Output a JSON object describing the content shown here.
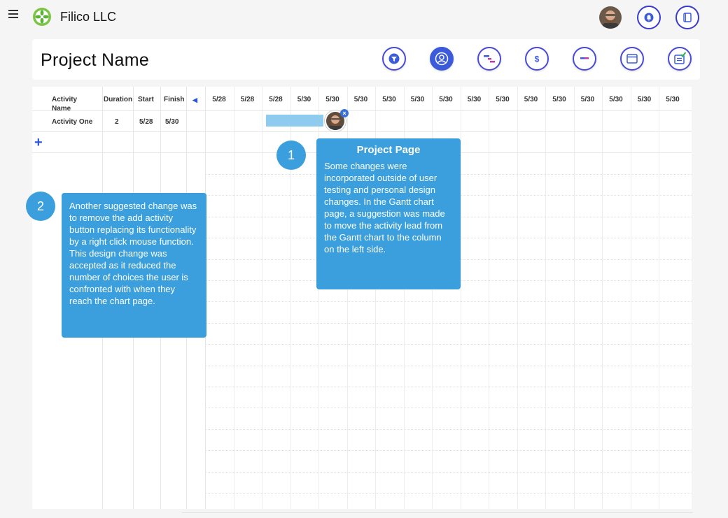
{
  "app": {
    "name": "Filico LLC"
  },
  "header": {
    "project_title": "Project Name"
  },
  "gantt": {
    "columns": {
      "activity_name": "Activity Name",
      "duration": "Duration",
      "start": "Start",
      "finish": "Finish"
    },
    "dates": [
      "5/28",
      "5/28",
      "5/28",
      "5/30",
      "5/30",
      "5/30",
      "5/30",
      "5/30",
      "5/30",
      "5/30",
      "5/30",
      "5/30",
      "5/30",
      "5/30",
      "5/30",
      "5/30",
      "5/30"
    ],
    "rows": [
      {
        "name": "Activity One",
        "duration": "2",
        "start": "5/28",
        "finish": "5/30"
      }
    ],
    "add_label": "+"
  },
  "annotations": [
    {
      "number": "1",
      "title": "Project Page",
      "text": "Some changes were incorporated outside of user testing and personal design changes. In the Gantt chart page, a suggestion was made to move the activity lead from the Gantt chart to the column on the left side."
    },
    {
      "number": "2",
      "title": "",
      "text": "Another suggested change was to remove the add activity button replacing its functionality by a right click mouse function. This design change was accepted as it reduced the number of choices the user is confronted with when they reach the chart page."
    }
  ],
  "colors": {
    "accent": "#3a9fdc",
    "bar": "#8ecbee",
    "button_border": "#4a4ad8"
  }
}
